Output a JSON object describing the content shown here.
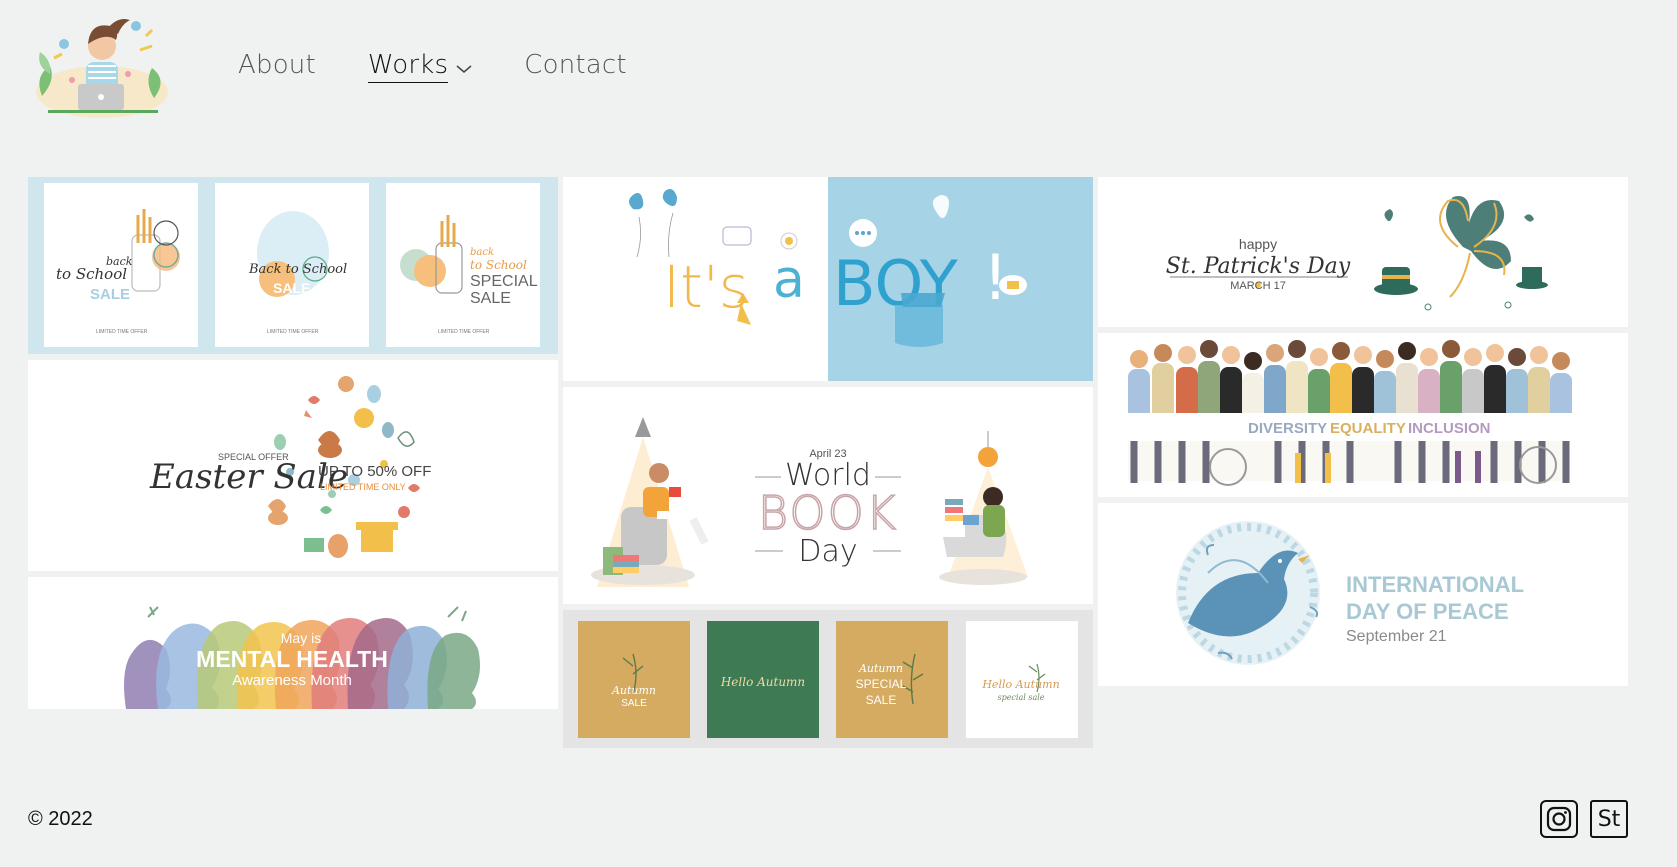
{
  "nav": {
    "items": [
      {
        "label": "About"
      },
      {
        "label": "Works"
      },
      {
        "label": "Contact"
      }
    ]
  },
  "gallery": {
    "back_to_school": {
      "card1_line1": "back",
      "card1_line2": "to School",
      "card1_line3": "SALE",
      "card2_line1": "Back to School",
      "card2_line2": "SALE",
      "card3_line1": "back",
      "card3_line2": "to School",
      "card3_line3": "SPECIAL",
      "card3_line4": "SALE",
      "fine_print": "LIMITED TIME OFFER"
    },
    "its_a_boy": {
      "word1": "It's",
      "word2": "a",
      "word3": "BOY",
      "mark": "!"
    },
    "st_patricks": {
      "line1": "happy",
      "line2": "St. Patrick's Day",
      "line3": "MARCH 17"
    },
    "easter": {
      "offer": "SPECIAL OFFER",
      "title": "Easter Sale",
      "discount": "UP TO 50% OFF",
      "limited": "LIMITED TIME ONLY"
    },
    "book_day": {
      "date": "April 23",
      "line1": "World",
      "line2": "BOOK",
      "line3": "Day"
    },
    "diversity": {
      "word1": "DIVERSITY",
      "word2": "EQUALITY",
      "word3": "INCLUSION"
    },
    "peace": {
      "line1": "INTERNATIONAL",
      "line2": "DAY OF PEACE",
      "date": "September 21"
    },
    "mental_health": {
      "line1": "May is",
      "line2": "MENTAL HEALTH",
      "line3": "Awareness Month"
    },
    "autumn": {
      "card1_title": "Autumn",
      "card1_sub": "SALE",
      "card2_title": "Hello Autumn",
      "card3_title": "Autumn",
      "card3_sub1": "SPECIAL",
      "card3_sub2": "SALE",
      "card4_title": "Hello Autumn",
      "card4_sub": "special sale"
    }
  },
  "footer": {
    "copyright": "© 2022",
    "stock_label": "St"
  },
  "colors": {
    "background": "#eff2f0",
    "light_blue": "#cfe6ee",
    "sky": "#a6d3e6",
    "mustard": "#d5aa61",
    "green": "#3e7a53",
    "peace_text": "#a8c9d4"
  }
}
